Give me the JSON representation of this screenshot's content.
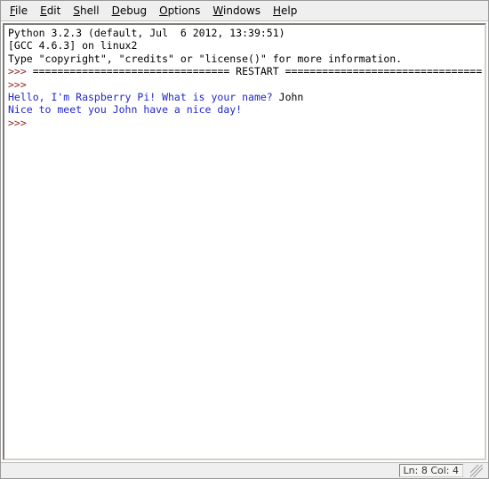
{
  "menu": {
    "items": [
      {
        "accel": "F",
        "rest": "ile"
      },
      {
        "accel": "E",
        "rest": "dit"
      },
      {
        "accel": "S",
        "rest": "hell"
      },
      {
        "accel": "D",
        "rest": "ebug"
      },
      {
        "accel": "O",
        "rest": "ptions"
      },
      {
        "accel": "W",
        "rest": "indows"
      },
      {
        "accel": "H",
        "rest": "elp"
      }
    ]
  },
  "shell": {
    "header_line1": "Python 3.2.3 (default, Jul  6 2012, 13:39:51)",
    "header_line2": "[GCC 4.6.3] on linux2",
    "header_line3": "Type \"copyright\", \"credits\" or \"license()\" for more information.",
    "prompt": ">>> ",
    "restart_line": "================================ RESTART ================================",
    "line_prompt_text": "Hello, I'm Raspberry Pi! What is your name? ",
    "user_input": "John",
    "line_response": "Nice to meet you John have a nice day!"
  },
  "status": {
    "line_label": "Ln: ",
    "line_value": "8",
    "col_label": "Col: ",
    "col_value": "4"
  }
}
